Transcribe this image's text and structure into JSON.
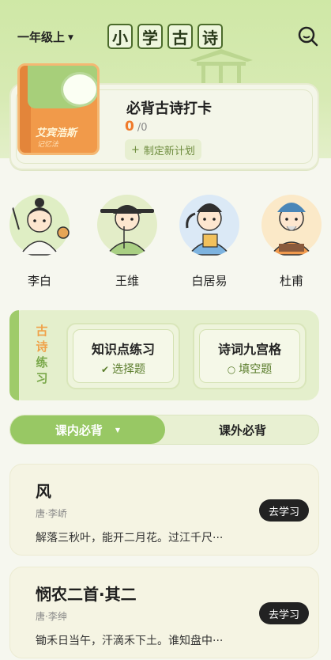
{
  "header": {
    "grade": "一年级上",
    "title_chars": [
      "小",
      "学",
      "古",
      "诗"
    ]
  },
  "checkin": {
    "brand": "艾宾浩斯",
    "brand_sub": "记忆法",
    "title": "必背古诗打卡",
    "done": "0",
    "total": "/0",
    "plan_button": "制定新计划"
  },
  "poets": [
    {
      "name": "李白",
      "color": "#dfeec4"
    },
    {
      "name": "王维",
      "color": "#e3edc8"
    },
    {
      "name": "白居易",
      "color": "#dbe9f6"
    },
    {
      "name": "杜甫",
      "color": "#fbe9c8"
    }
  ],
  "practice": {
    "label_chars": [
      "古",
      "诗",
      "练",
      "习"
    ],
    "cards": [
      {
        "title": "知识点练习",
        "sub": "选择题"
      },
      {
        "title": "诗词九宫格",
        "sub": "填空题"
      }
    ]
  },
  "tabs": {
    "active": "课内必背",
    "other": "课外必背"
  },
  "poems": [
    {
      "title": "风",
      "author": "唐·李峤",
      "excerpt": "解落三秋叶，能开二月花。过江千尺···",
      "button": "去学习"
    },
    {
      "title": "悯农二首·其二",
      "author": "唐·李绅",
      "excerpt": "锄禾日当午，汗滴禾下土。谁知盘中···",
      "button": "去学习"
    }
  ],
  "colors": {
    "accent_green": "#98c864",
    "orange": "#f07a2a",
    "header_bg": "#cfe8a6"
  }
}
